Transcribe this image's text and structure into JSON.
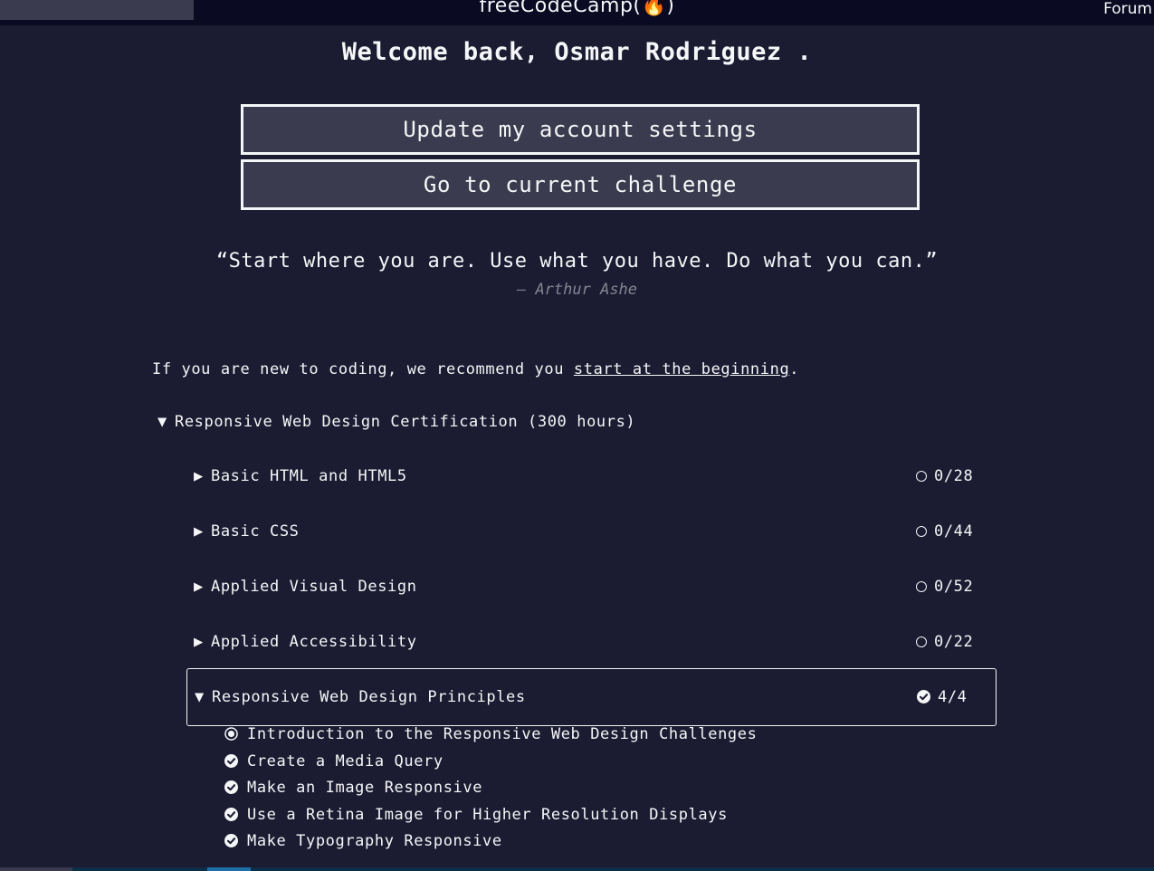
{
  "nav": {
    "logo": "freeCodeCamp(🔥)",
    "forum_label": "Forum"
  },
  "welcome": "Welcome back, Osmar Rodriguez .",
  "buttons": {
    "settings": "Update my account settings",
    "challenge": "Go to current challenge"
  },
  "quote": {
    "text": "“Start where you are. Use what you have. Do what you can.”",
    "author": "— Arthur Ashe"
  },
  "intro": {
    "text_before": "If you are new to coding, we recommend you ",
    "link": "start at the beginning",
    "text_after": "."
  },
  "certification": {
    "caret": "▼",
    "title": "Responsive Web Design Certification (300 hours)"
  },
  "blocks": [
    {
      "caret": "▶",
      "title": "Basic HTML and HTML5",
      "progress": "0/28",
      "complete": false
    },
    {
      "caret": "▶",
      "title": "Basic CSS",
      "progress": "0/44",
      "complete": false
    },
    {
      "caret": "▶",
      "title": "Applied Visual Design",
      "progress": "0/52",
      "complete": false
    },
    {
      "caret": "▶",
      "title": "Applied Accessibility",
      "progress": "0/22",
      "complete": false
    },
    {
      "caret": "▼",
      "title": "Responsive Web Design Principles",
      "progress": "4/4",
      "complete": true
    }
  ],
  "lessons": [
    {
      "title": "Introduction to the Responsive Web Design Challenges",
      "status": "intro"
    },
    {
      "title": "Create a Media Query",
      "status": "completed"
    },
    {
      "title": "Make an Image Responsive",
      "status": "completed"
    },
    {
      "title": "Use a Retina Image for Higher Resolution Displays",
      "status": "completed"
    },
    {
      "title": "Make Typography Responsive",
      "status": "completed"
    }
  ]
}
